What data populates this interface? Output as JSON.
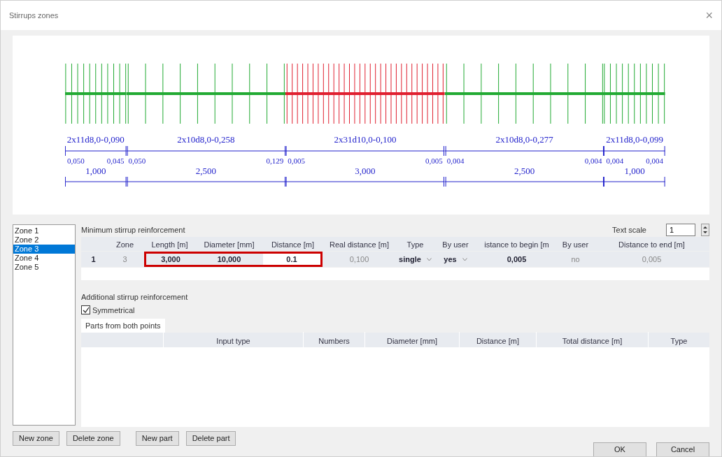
{
  "window": {
    "title": "Stirrups zones",
    "close": "×"
  },
  "drawing": {
    "zones": [
      {
        "kind": "end",
        "label": "2x11d8,0-0,090",
        "start": "0,050",
        "end": "0,045",
        "length": "1,000"
      },
      {
        "kind": "span",
        "label": "2x10d8,0-0,258",
        "start": "0,050",
        "end": "0,129",
        "length": "2,500"
      },
      {
        "kind": "span",
        "label": "2x31d10,0-0,100",
        "start": "0,005",
        "end": "0,005",
        "length": "3,000"
      },
      {
        "kind": "span",
        "label": "2x10d8,0-0,277",
        "start": "0,004",
        "end": "0,004",
        "length": "2,500"
      },
      {
        "kind": "end",
        "label": "2x11d8,0-0,099",
        "start": "0,004",
        "end": "0,004",
        "length": "1,000"
      }
    ]
  },
  "zones": [
    {
      "label": "Zone 1",
      "selected": false
    },
    {
      "label": "Zone 2",
      "selected": false
    },
    {
      "label": "Zone 3",
      "selected": true
    },
    {
      "label": "Zone 4",
      "selected": false
    },
    {
      "label": "Zone 5",
      "selected": false
    }
  ],
  "minimum": {
    "title": "Minimum stirrup reinforcement",
    "text_scale": {
      "label": "Text scale",
      "value": "1"
    },
    "columns": [
      "",
      "Zone",
      "Length [m]",
      "Diameter [mm]",
      "Distance [m]",
      "Real distance [m]",
      "Type",
      "By user",
      "istance to begin [m",
      "By user",
      "Distance to end [m]"
    ],
    "rows": [
      [
        {
          "text": "1",
          "kind": "index",
          "highlighted": false
        },
        {
          "text": "3",
          "kind": "muted",
          "highlighted": false
        },
        {
          "text": "3,000",
          "kind": "value",
          "highlighted": true
        },
        {
          "text": "10,000",
          "kind": "value",
          "highlighted": true
        },
        {
          "text": "0.1",
          "kind": "input",
          "highlighted": true
        },
        {
          "text": "0,100",
          "kind": "muted",
          "highlighted": false
        },
        {
          "text": "single",
          "kind": "dropdown",
          "highlighted": false
        },
        {
          "text": "yes",
          "kind": "dropdown",
          "highlighted": false
        },
        {
          "text": "0,005",
          "kind": "value",
          "highlighted": false
        },
        {
          "text": "no",
          "kind": "muted",
          "highlighted": false
        },
        {
          "text": "0,005",
          "kind": "muted",
          "highlighted": false
        }
      ]
    ]
  },
  "additional": {
    "title": "Additional stirrup reinforcement",
    "symmetrical": {
      "label": "Symmetrical",
      "checked": true
    },
    "tabs": [
      {
        "label": "Parts from both points",
        "selected": true
      }
    ],
    "columns": [
      "",
      "Input type",
      "Numbers",
      "Diameter [mm]",
      "Distance [m]",
      "Total distance [m]",
      "Type"
    ]
  },
  "buttons": [
    "New zone",
    "Delete zone",
    "New part",
    "Delete part"
  ],
  "dialog_buttons": [
    "OK",
    "Cancel"
  ]
}
